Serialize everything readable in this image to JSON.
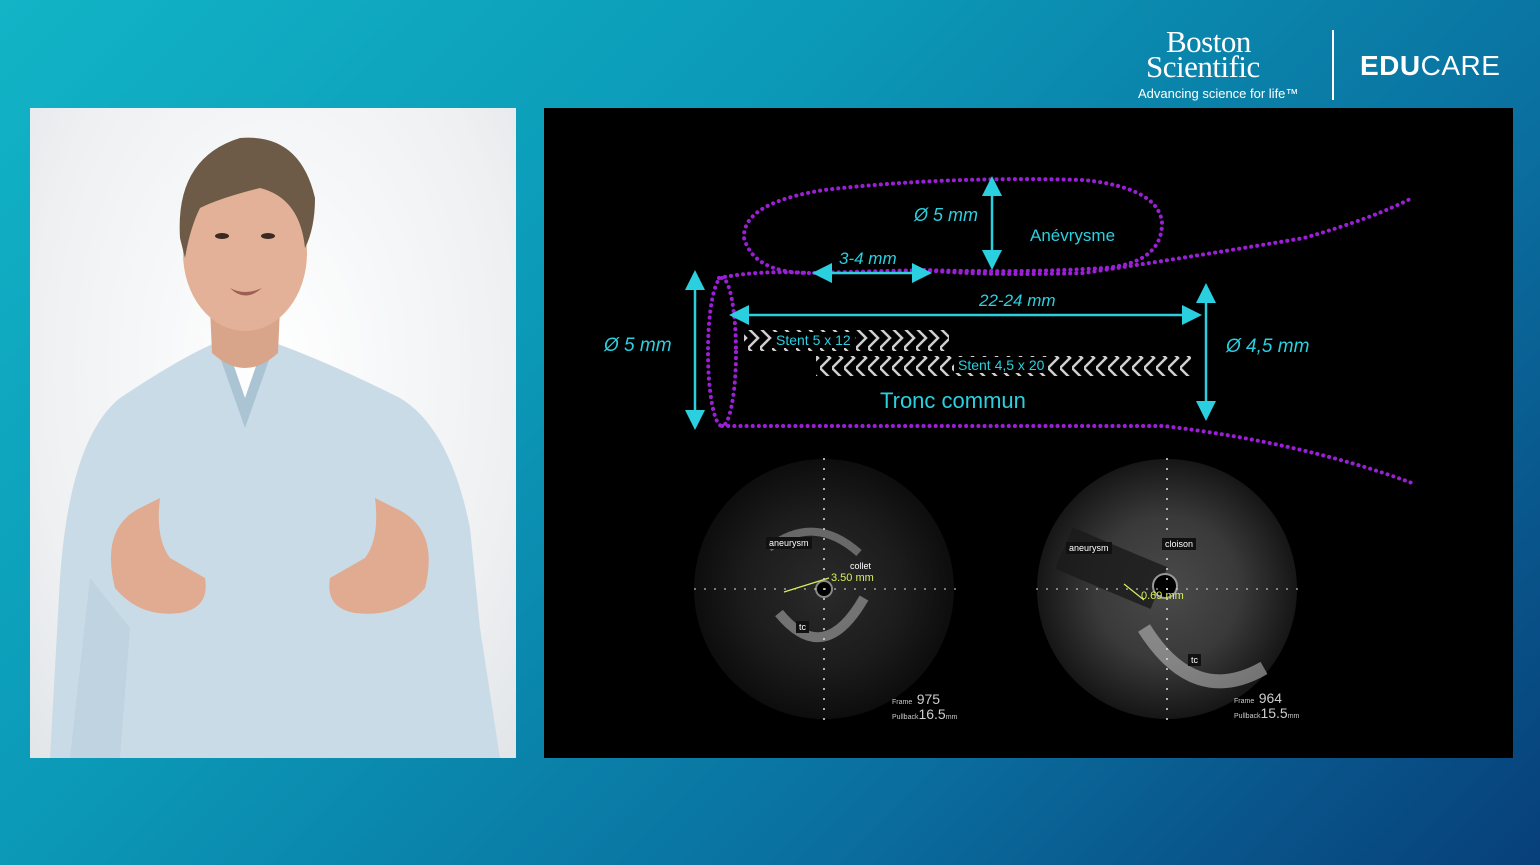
{
  "brand": {
    "logo_line1": "Boston",
    "logo_line2": "Scientific",
    "tagline": "Advancing science for life™",
    "product_bold": "EDU",
    "product_light": "CARE"
  },
  "diagram": {
    "aneurysm_diameter": "Ø 5 mm",
    "aneurysm_label": "Anévrysme",
    "neck_length": "3-4 mm",
    "stent_span": "22-24 mm",
    "inlet_diameter": "Ø 5 mm",
    "outlet_diameter": "Ø 4,5 mm",
    "stent1": "Stent 5 x 12",
    "stent2": "Stent 4,5 x 20",
    "vessel_label": "Tronc commun"
  },
  "ivus_left": {
    "aneurysm_tag": "aneurysm",
    "collet_tag": "collet",
    "measure": "3.50 mm",
    "tc_tag": "tc",
    "frame_label": "Frame",
    "frame_value": "975",
    "pullback_label": "Pullback",
    "pullback_value": "16.5",
    "pullback_unit": "mm"
  },
  "ivus_right": {
    "aneurysm_tag": "aneurysm",
    "cloison_tag": "cloison",
    "measure": "0.69 mm",
    "tc_tag": "tc",
    "frame_label": "Frame",
    "frame_value": "964",
    "pullback_label": "Pullback",
    "pullback_value": "15.5",
    "pullback_unit": "mm"
  },
  "colors": {
    "accent_cyan": "#2ad0e0",
    "outline_purple": "#9b1fd6",
    "measure_yellow": "#d7f05a"
  }
}
